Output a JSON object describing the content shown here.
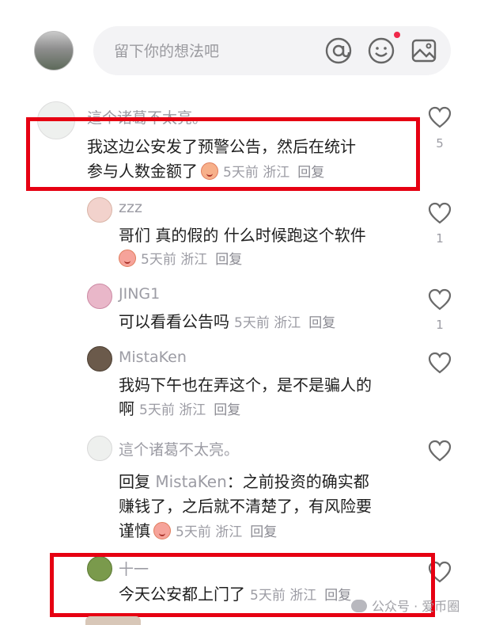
{
  "composer": {
    "placeholder": "留下你的想法吧",
    "icons": [
      "at-icon",
      "emoji-icon",
      "image-icon"
    ],
    "has_notification_dot": true
  },
  "comments": [
    {
      "author": "這个诸葛不太亮。",
      "text_lines": [
        "我这边公安发了预警公告，然后在统计",
        "参与人数金额了"
      ],
      "emoji": true,
      "time": "5天前",
      "location": "浙江",
      "reply_label": "回复",
      "likes": "5",
      "highlighted": true
    },
    {
      "author": "zzz",
      "text_lines": [
        "哥们 真的假的 什么时候跑这个软件"
      ],
      "emoji": true,
      "time": "5天前",
      "location": "浙江",
      "reply_label": "回复",
      "likes": "1"
    },
    {
      "author": "JING1",
      "text_lines": [
        "可以看看公告吗"
      ],
      "time": "5天前",
      "location": "浙江",
      "reply_label": "回复",
      "likes": "1"
    },
    {
      "author": "MistaKen",
      "text_lines": [
        "我妈下午也在弄这个，是不是骗人的",
        "啊"
      ],
      "time": "5天前",
      "location": "浙江",
      "reply_label": "回复",
      "likes": ""
    },
    {
      "author": "這个诸葛不太亮。",
      "reply_prefix": "回复",
      "reply_to": "MistaKen",
      "text_lines": [
        "：之前投资的确实都",
        "赚钱了，之后就不清楚了，有风险要",
        "谨慎"
      ],
      "emoji": true,
      "time": "5天前",
      "location": "浙江",
      "reply_label": "回复",
      "likes": ""
    },
    {
      "author": "十一",
      "text_lines": [
        "今天公安都上门了"
      ],
      "time": "5天前",
      "location": "浙江",
      "reply_label": "回复",
      "likes": "",
      "highlighted": true
    }
  ],
  "watermark": "公众号 · 爱币圈",
  "colors": {
    "highlight_box": "#e60012",
    "meta_text": "#9c9ca4",
    "notification_dot": "#f0284a"
  }
}
